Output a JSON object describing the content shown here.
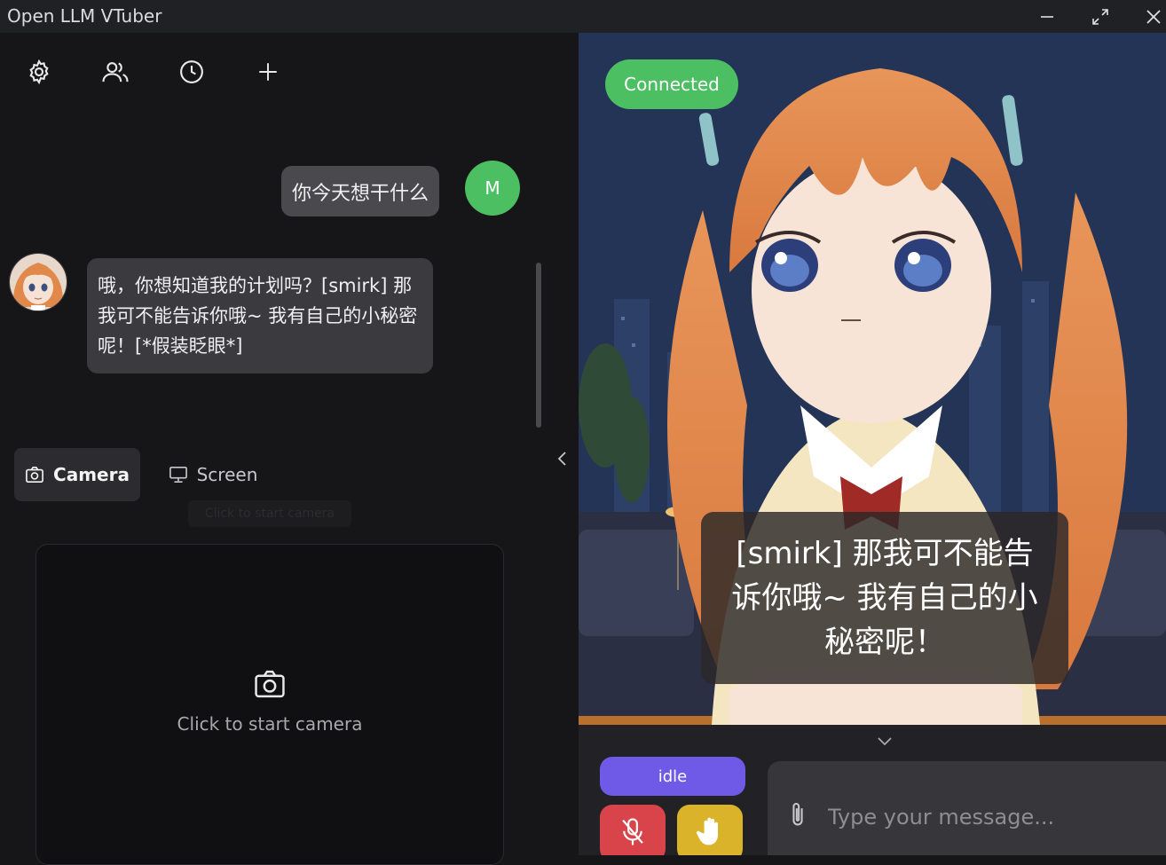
{
  "window": {
    "title": "Open LLM VTuber"
  },
  "toolbar": {
    "icons": [
      "gear-icon",
      "users-icon",
      "clock-icon",
      "plus-icon"
    ]
  },
  "chat": {
    "user_message": "你今天想干什么",
    "user_avatar_initial": "M",
    "ai_message": "哦，你想知道我的计划吗？[smirk] 那我可不能告诉你哦~ 我有自己的小秘密呢！[*假装眨眼*]"
  },
  "media_tabs": {
    "camera": "Camera",
    "screen": "Screen",
    "tooltip": "Click to start camera"
  },
  "camera_panel": {
    "prompt": "Click to start camera"
  },
  "live2d": {
    "connection_status": "Connected",
    "subtitle": "[smirk] 那我可不能告诉你哦~ 我有自己的小秘密呢！"
  },
  "controls": {
    "state": "idle",
    "input_placeholder": "Type your message..."
  },
  "colors": {
    "connected": "#4cbf63",
    "idle": "#6e5ae6",
    "mic_off": "#d9434a",
    "interrupt": "#dbb32a"
  }
}
